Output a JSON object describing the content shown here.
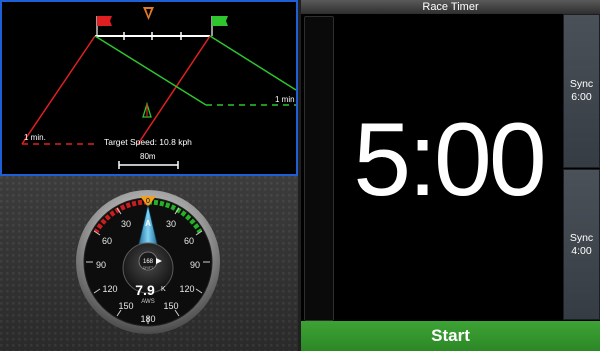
{
  "race_timer": {
    "title": "Race Timer",
    "time": "5:00",
    "sync_buttons": [
      {
        "label": "Sync",
        "value": "6:00"
      },
      {
        "label": "Sync",
        "value": "4:00"
      }
    ],
    "start_label": "Start"
  },
  "start_line_chart": {
    "left_time_label": "1 min.",
    "right_time_label": "1 min",
    "target_speed_label": "Target Speed: 10.8 kph",
    "scale_label": "80m",
    "pin_flag_color": "#e02020",
    "boat_flag_color": "#2ec52e"
  },
  "wind_gauge": {
    "top_marker": "0",
    "left_scale": [
      "30",
      "60",
      "90",
      "120",
      "150"
    ],
    "right_scale": [
      "30",
      "60",
      "90",
      "120",
      "150"
    ],
    "bottom_label": "180",
    "pointer_letter": "A",
    "drift_value": "168",
    "drift_label": "DRIFT",
    "aws_value": "7.9",
    "aws_unit": "K",
    "aws_label": "AWS"
  }
}
